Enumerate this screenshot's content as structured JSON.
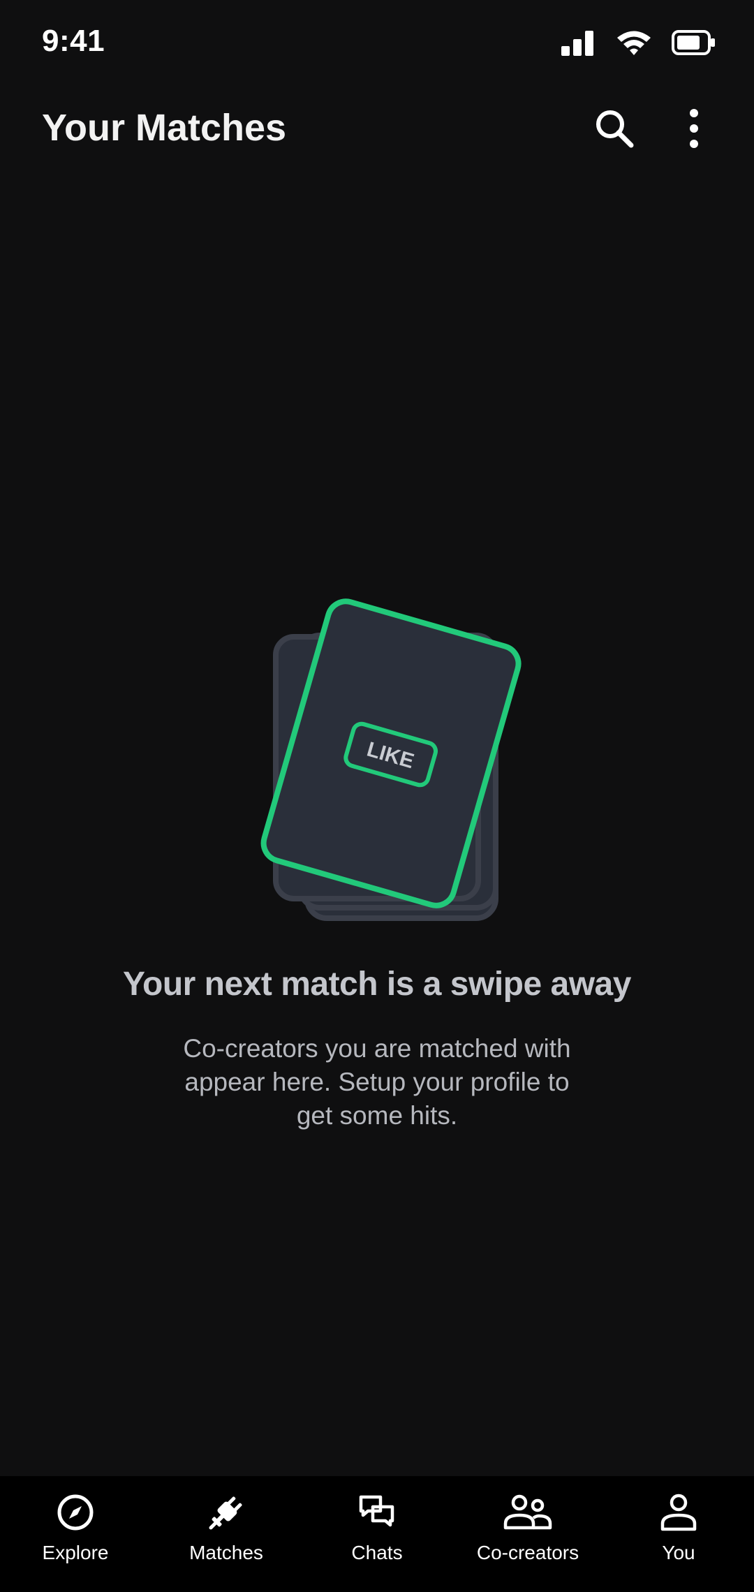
{
  "status_bar": {
    "time": "9:41",
    "icons": [
      "cellular-signal-icon",
      "wifi-icon",
      "battery-icon"
    ]
  },
  "header": {
    "title": "Your Matches",
    "actions": [
      "search-icon",
      "more-vertical-icon"
    ]
  },
  "empty_state": {
    "illustration": "card-stack-like-icon",
    "card_label": "LIKE",
    "title": "Your next match is a swipe away",
    "description": "Co-creators you are matched with appear here. Setup your profile to get some hits."
  },
  "bottom_nav": {
    "items": [
      {
        "label": "Explore",
        "icon": "compass-icon"
      },
      {
        "label": "Matches",
        "icon": "plug-icon",
        "active": true
      },
      {
        "label": "Chats",
        "icon": "chat-bubbles-icon"
      },
      {
        "label": "Co-creators",
        "icon": "people-icon"
      },
      {
        "label": "You",
        "icon": "person-icon"
      }
    ]
  },
  "colors": {
    "background": "#0f0f10",
    "nav_background": "#000000",
    "card_fill": "#2a2f3a",
    "card_back": "#3b3f4a",
    "accent_green": "#22c97a",
    "title_text": "#c4c6cc"
  }
}
